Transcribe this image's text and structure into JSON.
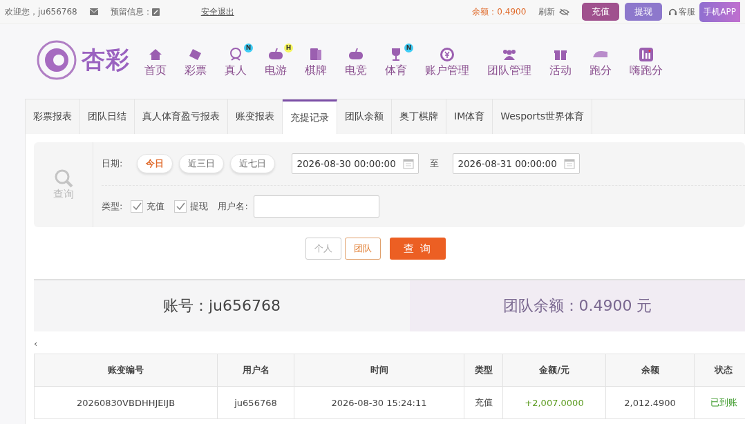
{
  "top_bar": {
    "greeting": "欢迎您，ju656768",
    "message_label": "预留信息：",
    "logout": "安全退出",
    "balance": "余额：0.4900",
    "refresh": "刷新",
    "buttons": [
      {
        "label": "充值",
        "kind": "deposit"
      },
      {
        "label": "提现",
        "kind": "withdraw"
      }
    ],
    "service": "客服",
    "app": "手机APP"
  },
  "logo": {
    "text": "杏彩"
  },
  "nav": [
    {
      "label": "首页"
    },
    {
      "label": "彩票"
    },
    {
      "label": "真人",
      "badge": "N"
    },
    {
      "label": "电游",
      "badge": "H"
    },
    {
      "label": "棋牌"
    },
    {
      "label": "电竞"
    },
    {
      "label": "体育",
      "badge": "N"
    },
    {
      "label": "账户管理"
    },
    {
      "label": "团队管理"
    },
    {
      "label": "活动"
    },
    {
      "label": "跑分"
    },
    {
      "label": "嗨跑分"
    }
  ],
  "tabs": [
    {
      "label": "彩票报表",
      "selected": false
    },
    {
      "label": "团队日结",
      "selected": false
    },
    {
      "label": "真人体育盈亏报表",
      "selected": false
    },
    {
      "label": "账变报表",
      "selected": false
    },
    {
      "label": "充提记录",
      "selected": true
    },
    {
      "label": "团队余额",
      "selected": false
    },
    {
      "label": "奥丁棋牌",
      "selected": false
    },
    {
      "label": "IM体育",
      "selected": false
    },
    {
      "label": "Wesports世界体育",
      "selected": false
    }
  ],
  "filter": {
    "side_label": "查询",
    "date_label": "日期:",
    "quick_dates": [
      {
        "label": "今日",
        "selected": true
      },
      {
        "label": "近三日",
        "selected": false
      },
      {
        "label": "近七日",
        "selected": false
      }
    ],
    "start": "2026-08-30 00:00:00",
    "to": "至",
    "end": "2026-08-31 00:00:00",
    "type_label": "类型:",
    "types": [
      {
        "label": "充值",
        "checked": true
      },
      {
        "label": "提现",
        "checked": true
      }
    ],
    "username_label": "用户名:"
  },
  "scope": [
    {
      "label": "个人",
      "selected": false
    },
    {
      "label": "团队",
      "selected": true
    }
  ],
  "query_button": "查 询",
  "summary": {
    "account": "账号：ju656768",
    "team_balance": "团队余额：0.4900 元"
  },
  "scroll_hint": "‹",
  "table": {
    "columns": [
      "账变编号",
      "用户名",
      "时间",
      "类型",
      "金额/元",
      "余额",
      "状态"
    ],
    "rows": [
      {
        "id": "20260830VBDHHJEIJB",
        "user": "ju656768",
        "time": "2026-08-30 15:24:11",
        "type": "充值",
        "amount": "+2,007.0000",
        "balance": "2,012.4900",
        "status": "已到账"
      }
    ]
  }
}
